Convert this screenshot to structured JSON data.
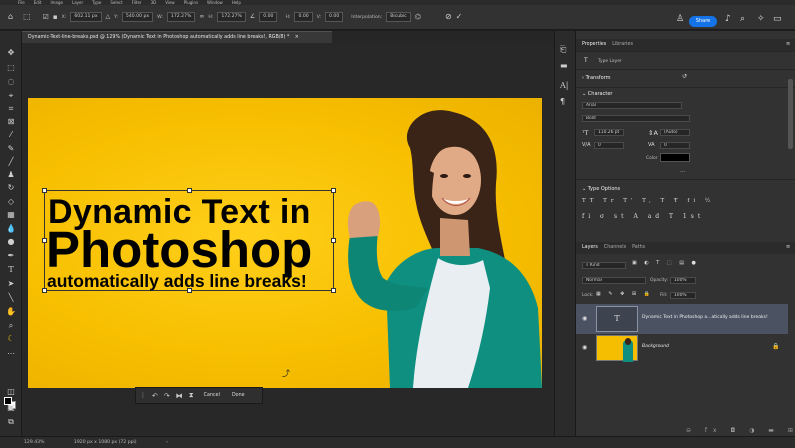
{
  "menubar": {
    "items": [
      "File",
      "Edit",
      "Image",
      "Layer",
      "Type",
      "Select",
      "Filter",
      "3D",
      "View",
      "Plugins",
      "Window",
      "Help"
    ]
  },
  "options": {
    "x_label": "X:",
    "x_value": "602.11 px",
    "y_label": "Y:",
    "y_value": "540.00 px",
    "w_label": "W:",
    "w_value": "172.27%",
    "h_label": "H:",
    "h_value": "172.27%",
    "angle_value": "0.00",
    "hskew_label": "H:",
    "hskew_value": "0.00",
    "vskew_label": "V:",
    "vskew_value": "0.00",
    "interp_label": "Interpolation:",
    "interp_value": "Bicubic",
    "share_label": "Share"
  },
  "document": {
    "tab_title": "Dynamic-Text-line-breaks.psd @ 129% (Dynamic Text in Photoshop automatically adds line breaks!, RGB/8) *",
    "text_line1": "Dynamic Text in",
    "text_line2": "Photoshop",
    "text_line3": "automatically adds line breaks!"
  },
  "contextual_bar": {
    "cancel_label": "Cancel",
    "done_label": "Done"
  },
  "status": {
    "zoom": "129.43%",
    "doc_size": "1920 px x 1080 px (72 ppi)"
  },
  "properties": {
    "tabs": [
      "Properties",
      "Libraries"
    ],
    "layer_type": "Type Layer",
    "transform_label": "Transform",
    "character_label": "Character",
    "font_family": "Arial",
    "font_style": "Bold",
    "font_size": "110.26 pt",
    "leading": "(Auto)",
    "tracking": "0",
    "kerning": "0",
    "color_label": "Color",
    "more": "...",
    "type_options_label": "Type Options",
    "text_color": "#000000"
  },
  "layers": {
    "tabs": [
      "Layers",
      "Channels",
      "Paths"
    ],
    "kind_placeholder": "Kind",
    "blend_mode": "Normal",
    "opacity_label": "Opacity:",
    "opacity_value": "100%",
    "lock_label": "Lock:",
    "fill_label": "Fill:",
    "fill_value": "100%",
    "rows": [
      {
        "name": "Dynamic Text in Photoshop a...atically adds line breaks!",
        "selected": true
      },
      {
        "name": "Background",
        "italic": true
      }
    ]
  },
  "colors": {
    "accent": "#1473e6",
    "canvas_yellow": "#f7bf00",
    "teal_shirt": "#0f8f80"
  }
}
